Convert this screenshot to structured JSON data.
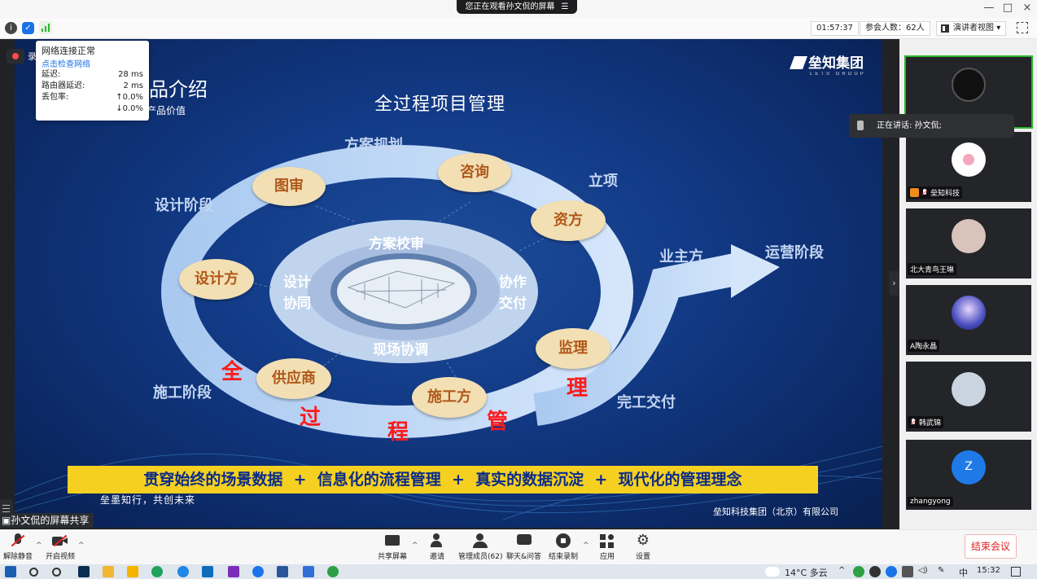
{
  "window": {
    "title": "您正在观看孙文侃的屏幕",
    "controls": [
      "—",
      "□",
      "×"
    ]
  },
  "toolbar": {
    "timer": "01:57:37",
    "participants": "参会人数：62人",
    "view": "演讲者视图"
  },
  "recording": {
    "label": "录"
  },
  "network_popup": {
    "status": "网络连接正常",
    "check_link": "点击检查网络",
    "rows": [
      {
        "label": "延迟:",
        "value": "28 ms"
      },
      {
        "label": "路由器延迟:",
        "value": "2 ms"
      },
      {
        "label": "丢包率:",
        "value": "↑0.0%"
      },
      {
        "label": "",
        "value": "↓0.0%"
      }
    ]
  },
  "slide": {
    "logo": "垒知集团",
    "logo_sub": "LETS GROUP",
    "heading": "品介绍",
    "subheading": "产品价值",
    "title": "全过程项目管理",
    "phases": {
      "design": "设计阶段",
      "planning": "方案规划",
      "approval": "立项",
      "construction": "施工阶段",
      "delivery": "完工交付",
      "owner": "业主方",
      "operation": "运营阶段"
    },
    "ovals": {
      "drawing_review": "图审",
      "consulting": "咨询",
      "funder": "资方",
      "designer": "设计方",
      "supplier": "供应商",
      "contractor": "施工方",
      "supervisor": "监理"
    },
    "inner": {
      "top": "方案校审",
      "left": "设计协同",
      "right": "协作交付",
      "bottom": "现场协调"
    },
    "red_chars": [
      "全",
      "过",
      "程",
      "管",
      "理"
    ],
    "banner": "贯穿始终的场景数据  +  信息化的流程管理  +  真实的数据沉淀  +  现代化的管理理念",
    "motto": "垒墨知行，共创未来",
    "company": "垒知科技集团（北京）有限公司"
  },
  "share_label": "孙文侃的屏幕共享",
  "speaking": "正在讲话: 孙文侃;",
  "participants": [
    {
      "name": "",
      "avatar_color": "#111111",
      "icon": "person-photo"
    },
    {
      "name": "垒知科技",
      "avatar_color": "#f4c7d3",
      "icon": "flower"
    },
    {
      "name": "北大青鸟王琳",
      "avatar_color": "#d9c3bb",
      "icon": "cartoon"
    },
    {
      "name": "A陶永晶",
      "avatar_color": "#4a4fc0",
      "icon": "night-sky"
    },
    {
      "name": "韩武锦",
      "avatar_color": "#c9d4e0",
      "icon": "group-photo"
    },
    {
      "name": "zhangyong",
      "avatar_color": "#1f7ae8",
      "icon": "Z"
    }
  ],
  "bottom_controls": {
    "unmute": "解除静音",
    "start_video": "开启视频",
    "share_screen": "共享屏幕",
    "invite": "邀请",
    "manage": "管理成员(62)",
    "chat": "聊天&问答",
    "stop_recording": "结束录制",
    "apps": "应用",
    "settings": "设置",
    "end_meeting": "结束会议"
  },
  "taskbar": {
    "weather": "14°C 多云",
    "ime": "中",
    "time": "15:32"
  },
  "colors": {
    "slide_bg": "#123a86",
    "ring": "#b8d4f5",
    "oval": "#f2dfb4",
    "oval_text": "#b0581a",
    "red": "#ff1a1a",
    "banner_bg": "#f5d020",
    "banner_text": "#0a2b8a",
    "end_red": "#e02020"
  }
}
